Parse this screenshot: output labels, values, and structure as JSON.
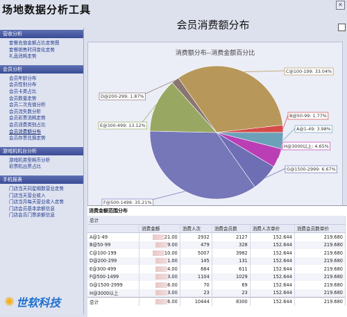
{
  "app": {
    "title": "场地数据分析工具"
  },
  "window": {
    "close_label": "×"
  },
  "sidebar": {
    "sections": [
      {
        "title": "营收分析",
        "items": [
          "套餐充值金额占比走势图",
          "套餐销售时间变化走势",
          "礼品消耗走势"
        ]
      },
      {
        "title": "会员分析",
        "items": [
          "会员年龄分布",
          "会员性别分布",
          "会员卡类占比",
          "会员数量走势",
          "会员二次充值分析",
          "会员流失数分析",
          "会员彩票消耗走势",
          "会员消费类别占比",
          "会员消费额分布",
          "会员存票兑换走势"
        ]
      },
      {
        "title": "游戏机机台分析",
        "items": [
          "游戏机类型耗币分析",
          "彩票机出票占比"
        ]
      },
      {
        "title": "手机报表",
        "items": [
          "门店当天同星期数营业走势",
          "门店当天营业收入",
          "门店当月每天营业收入走势",
          "门店会员基本余额信息",
          "门店会员门票余额信息"
        ]
      }
    ],
    "active_item": "会员消费额分布",
    "logo": {
      "text": "世软科技"
    }
  },
  "main": {
    "title": "会员消费额分布",
    "chart": {
      "title": "消费额分布--消费金额百分比",
      "slices": [
        {
          "label": "C@100-199: 33.04%",
          "value": 33.04,
          "color": "#b7985a"
        },
        {
          "label": "B@50-99: 1.77%",
          "value": 1.77,
          "color": "#d64a4a"
        },
        {
          "label": "A@1-49: 3.98%",
          "value": 3.98,
          "color": "#6aa1b8"
        },
        {
          "label": "H@3000以上: 4.65%",
          "value": 4.65,
          "color": "#bb3eb5"
        },
        {
          "label": "G@1500-2999: 6.67%",
          "value": 6.67,
          "color": "#6e6eb4"
        },
        {
          "label": "F@500-1499: 35.21%",
          "value": 35.21,
          "color": "#7677b8"
        },
        {
          "label": "E@300-499: 13.12%",
          "value": 13.12,
          "color": "#98a862"
        },
        {
          "label": "D@200-299: 1.87%",
          "value": 1.87,
          "color": "#8a7670"
        }
      ]
    }
  },
  "report": {
    "title": "消费金额范围分布",
    "group_header": "总计",
    "columns": [
      "",
      "消费金额",
      "消费人次",
      "消费会员数",
      "消费人次单价",
      "消费会员数单价"
    ],
    "rows": [
      [
        "A@1-49",
        "21.00",
        "2932",
        "2127",
        "152.644",
        "219.680"
      ],
      [
        "B@50-99",
        "9.00",
        "479",
        "328",
        "152.644",
        "219.680"
      ],
      [
        "C@100-199",
        "10.00",
        "5007",
        "3982",
        "152.644",
        "219.680"
      ],
      [
        "D@200-299",
        "1.00",
        "145",
        "131",
        "152.644",
        "219.680"
      ],
      [
        "E@300-499",
        "4.00",
        "684",
        "611",
        "152.644",
        "219.680"
      ],
      [
        "F@500-1499",
        "3.00",
        "1104",
        "1029",
        "152.644",
        "219.680"
      ],
      [
        "G@1500-2999",
        "6.00",
        "70",
        "69",
        "152.644",
        "219.680"
      ],
      [
        "H@3000以上",
        "3.00",
        "23",
        "23",
        "152.644",
        "219.680"
      ],
      [
        "总计",
        "6.00",
        "10444",
        "8300",
        "152.644",
        "219.680"
      ]
    ]
  }
}
